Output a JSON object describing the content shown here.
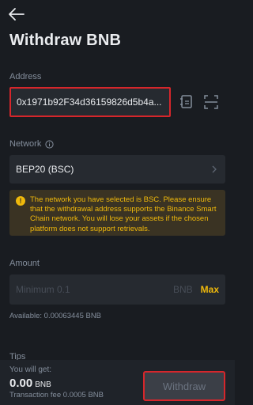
{
  "header": {
    "title": "Withdraw BNB",
    "back_icon": "arrow-left-icon"
  },
  "address": {
    "label": "Address",
    "value": "0x1971b92F34d36159826d5b4a...",
    "address_book_icon": "address-book-icon",
    "scan_icon": "scan-icon"
  },
  "network": {
    "label": "Network",
    "info_icon": "info-icon",
    "selected": "BEP20 (BSC)",
    "chevron_icon": "chevron-right-icon"
  },
  "warning": {
    "icon": "exclamation-icon",
    "text": "The network you have selected is BSC. Please ensure that the withdrawal address supports the Binance Smart Chain network. You will lose your assets if the chosen platform does not support retrievals."
  },
  "amount": {
    "label": "Amount",
    "placeholder": "Minimum 0.1",
    "unit": "BNB",
    "max_label": "Max",
    "available": "Available: 0.00063445 BNB"
  },
  "tips": {
    "label": "Tips"
  },
  "footer": {
    "get_label": "You will get:",
    "get_value": "0.00",
    "get_unit": "BNB",
    "fee": "Transaction fee  0.0005 BNB",
    "withdraw_label": "Withdraw"
  },
  "colors": {
    "background": "#191C21",
    "field": "#262A30",
    "accent": "#F0B90B",
    "highlight_border": "#D6262B",
    "muted_text": "#848E9C"
  }
}
